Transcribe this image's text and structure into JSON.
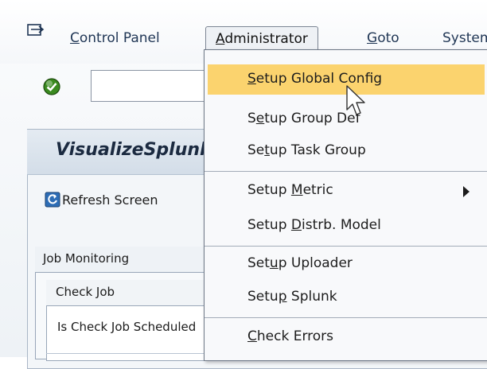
{
  "menubar": {
    "items": [
      "Control Panel",
      "Administrator",
      "Goto",
      "System"
    ]
  },
  "panel": {
    "title": "VisualizeSplunk",
    "refresh_label": "Refresh Screen"
  },
  "tabs": {
    "group_label": "Job Monitoring",
    "subgroup_label": "Check Job",
    "row_label": "Is Check Job Scheduled"
  },
  "dropdown": {
    "items": [
      {
        "pre": "",
        "key": "S",
        "post": "etup Global Config",
        "highlighted": true
      },
      {
        "pre": "S",
        "key": "e",
        "post": "tup Group Def"
      },
      {
        "pre": "Se",
        "key": "t",
        "post": "up Task Group"
      },
      {
        "pre": "Setup ",
        "key": "M",
        "post": "etric",
        "submenu": true
      },
      {
        "pre": "Setup ",
        "key": "D",
        "post": "istrb. Model"
      },
      {
        "pre": "Set",
        "key": "u",
        "post": "p Uploader"
      },
      {
        "pre": "Setu",
        "key": "p",
        "post": " Splunk"
      },
      {
        "pre": "",
        "key": "C",
        "post": "heck Errors"
      }
    ]
  },
  "colors": {
    "highlight": "#fbd36e",
    "menu_text": "#1f3554",
    "check_green": "#3a8a1f"
  }
}
